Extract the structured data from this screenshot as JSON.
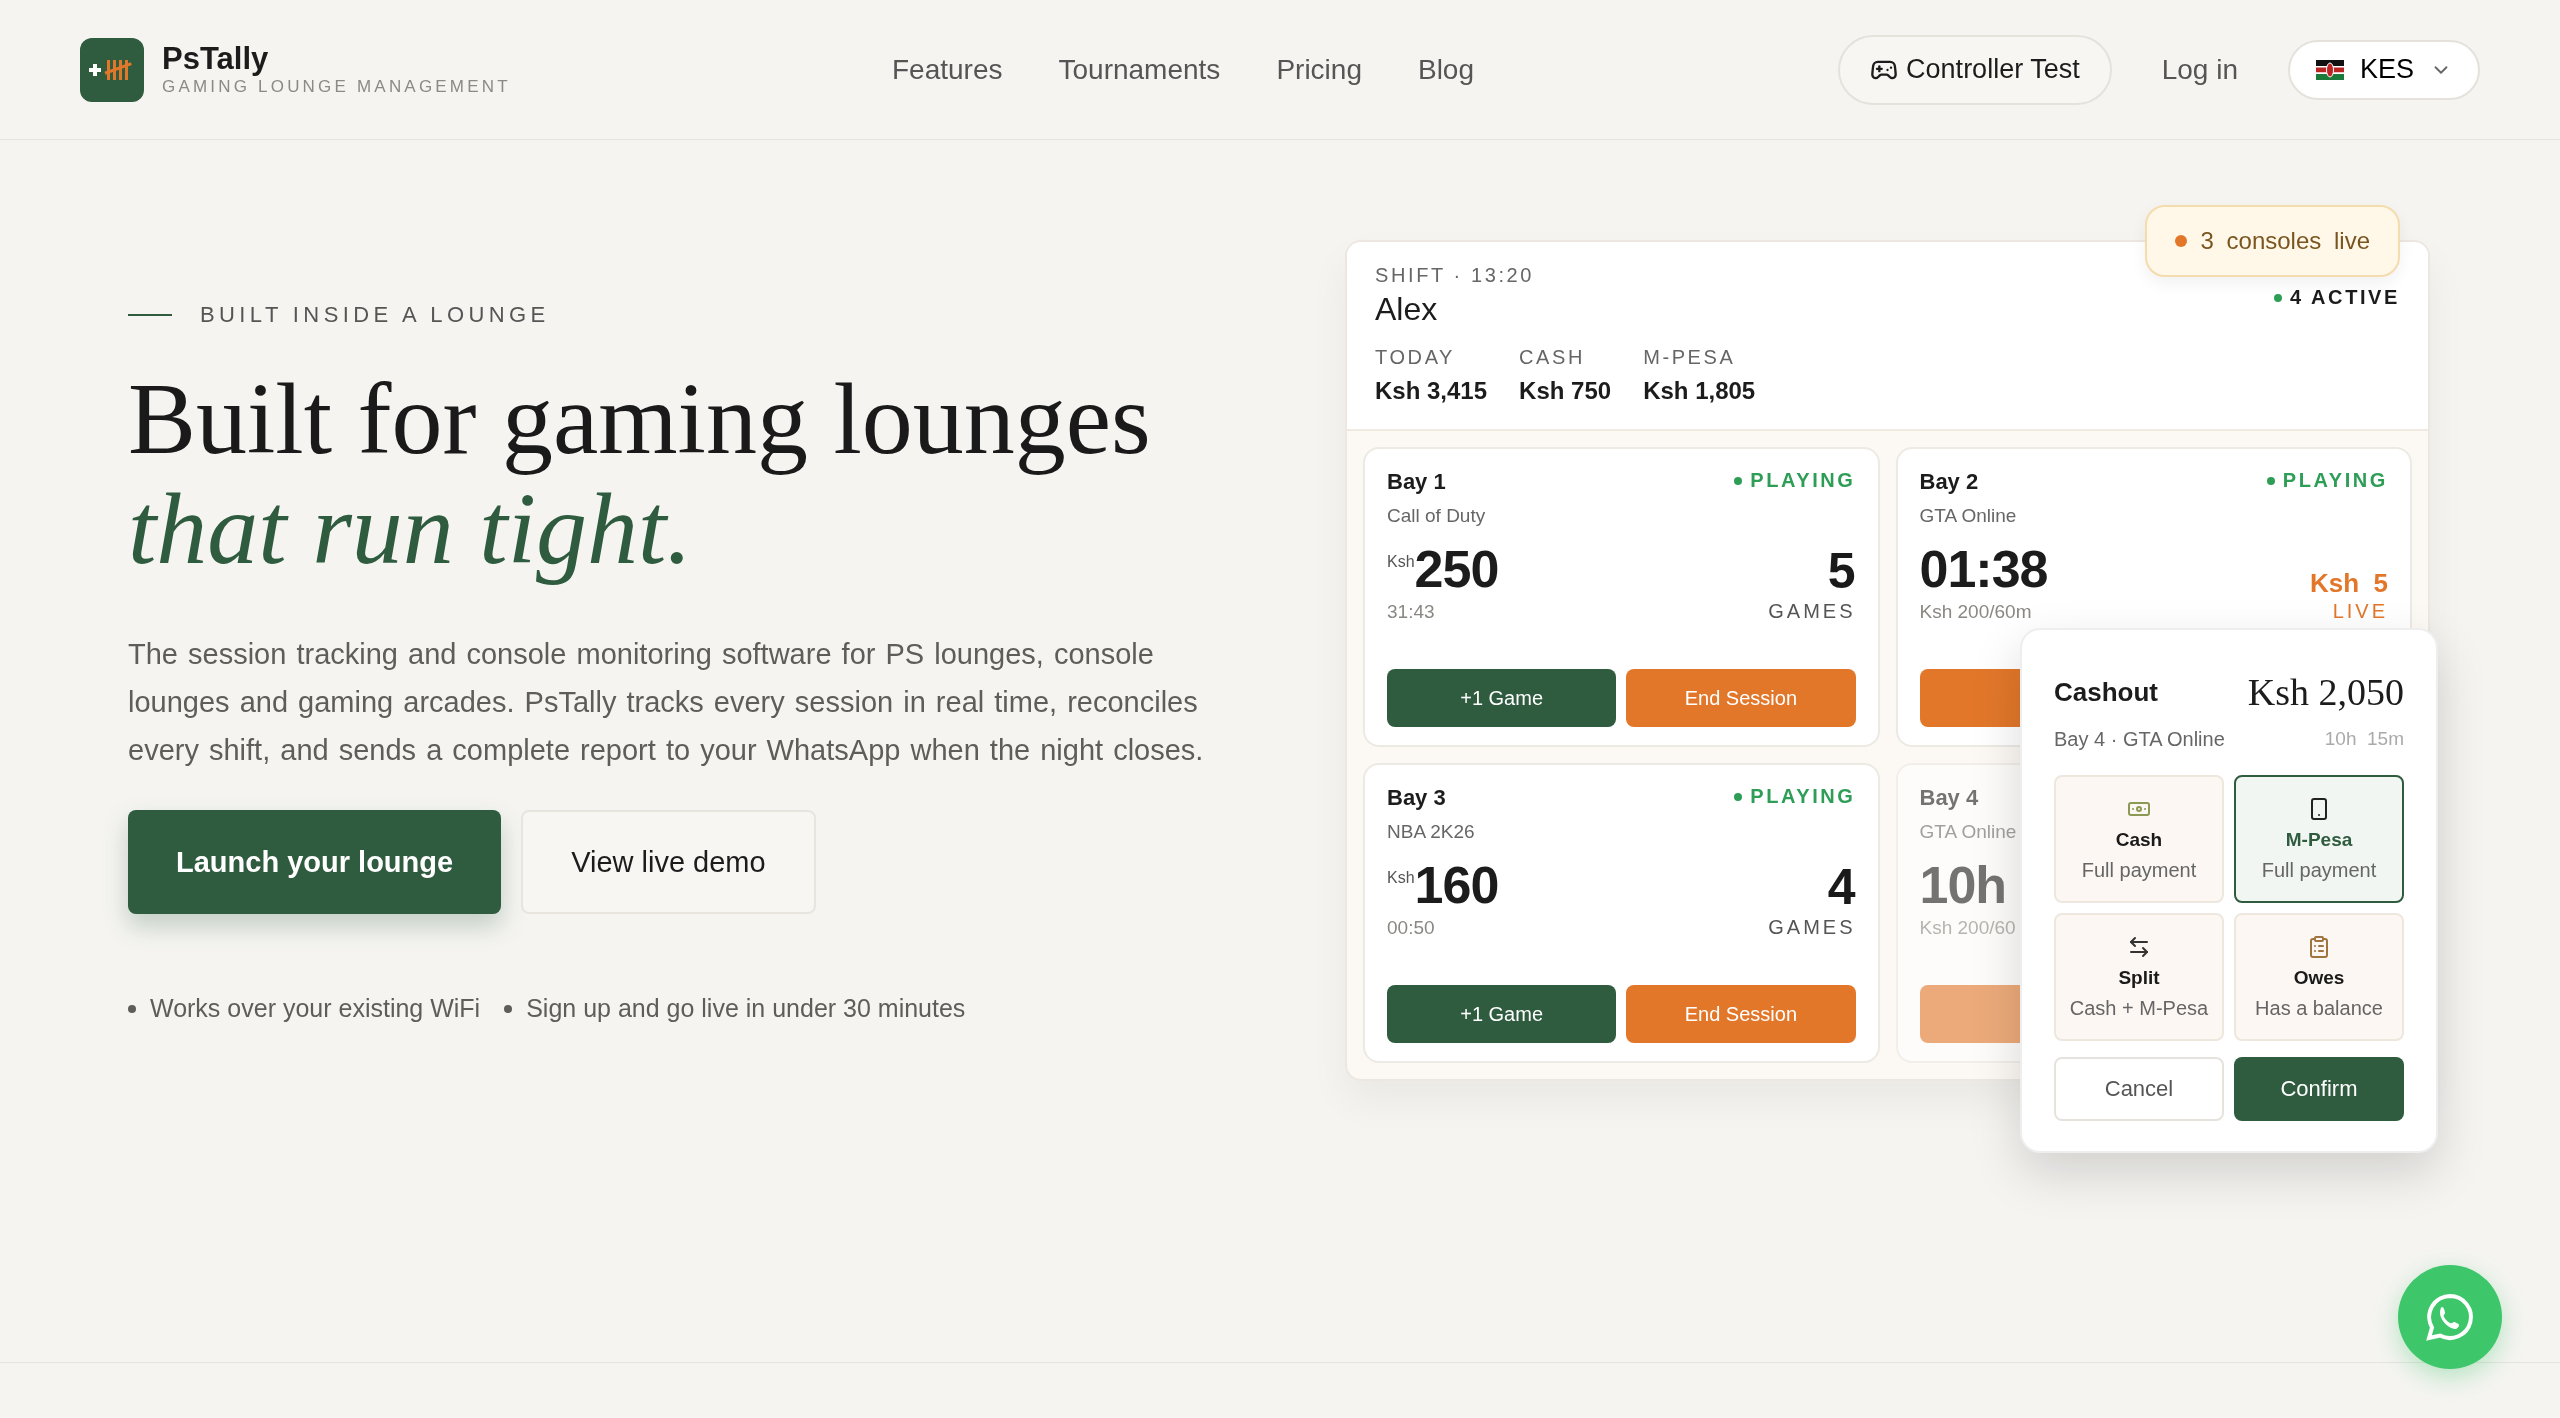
{
  "brand": {
    "name": "PsTally",
    "tagline": "GAMING LOUNGE MANAGEMENT"
  },
  "nav": [
    {
      "label": "Features"
    },
    {
      "label": "Tournaments"
    },
    {
      "label": "Pricing"
    },
    {
      "label": "Blog"
    }
  ],
  "header_actions": {
    "controller_test": "Controller Test",
    "login": "Log in",
    "currency": "KES"
  },
  "hero": {
    "eyebrow": "BUILT INSIDE A LOUNGE",
    "title_line": "Built for gaming lounges",
    "title_accent": "that run tight.",
    "description": "The session tracking and console monitoring software for PS lounges, console lounges and gaming arcades. PsTally tracks every session in real time, reconciles every shift, and sends a complete report to your WhatsApp when the night closes.",
    "primary_button": "Launch your lounge",
    "secondary_button": "View live demo",
    "bullets": [
      "Works over your existing WiFi",
      "Sign up and go live in under 30 minutes"
    ]
  },
  "dashboard": {
    "shift": "SHIFT · 13:20",
    "active": "4 ACTIVE",
    "staff": "Alex",
    "stats": [
      {
        "label": "TODAY",
        "value": "Ksh 3,415"
      },
      {
        "label": "CASH",
        "value": "Ksh 750"
      },
      {
        "label": "M-PESA",
        "value": "Ksh 1,805"
      }
    ],
    "live_badge": {
      "count": "3",
      "label": "consoles",
      "suffix": "live"
    },
    "bays": [
      {
        "name": "Bay 1",
        "game": "Call of Duty",
        "status": "PLAYING",
        "dimmed": false,
        "kind": "amount",
        "prefix": "Ksh",
        "value": "250",
        "sub": "31:43",
        "right": {
          "kind": "games",
          "value": "5",
          "label": "GAMES"
        },
        "buttons": [
          {
            "kind": "add",
            "label": "+1 Game"
          },
          {
            "kind": "end",
            "label": "End Session"
          }
        ]
      },
      {
        "name": "Bay 2",
        "game": "GTA Online",
        "status": "PLAYING",
        "dimmed": false,
        "kind": "timer",
        "value": "01:38",
        "sub": "Ksh 200/60m",
        "right": {
          "kind": "live",
          "value": "Ksh  5",
          "label": "LIVE"
        },
        "buttons": [
          {
            "kind": "end"
          }
        ]
      },
      {
        "name": "Bay 3",
        "game": "NBA 2K26",
        "status": "PLAYING",
        "dimmed": false,
        "kind": "amount",
        "prefix": "Ksh",
        "value": "160",
        "sub": "00:50",
        "right": {
          "kind": "games",
          "value": "4",
          "label": "GAMES"
        },
        "buttons": [
          {
            "kind": "add",
            "label": "+1 Game"
          },
          {
            "kind": "end",
            "label": "End Session"
          }
        ]
      },
      {
        "name": "Bay 4",
        "game": "GTA Online",
        "dimmed": true,
        "kind": "timer",
        "value": "10h",
        "sub": "Ksh 200/60",
        "buttons": [
          {
            "kind": "end"
          }
        ]
      }
    ]
  },
  "cashout": {
    "title": "Cashout",
    "amount": "Ksh 2,050",
    "context": "Bay 4 · GTA Online",
    "duration": "10h  15m",
    "options": [
      {
        "kind": "cash",
        "title": "Cash",
        "subtitle": "Full payment",
        "selected": false
      },
      {
        "kind": "mpesa",
        "title": "M-Pesa",
        "subtitle": "Full payment",
        "selected": true
      },
      {
        "kind": "split",
        "title": "Split",
        "subtitle": "Cash + M-Pesa",
        "selected": false
      },
      {
        "kind": "owes",
        "title": "Owes",
        "subtitle": "Has a balance",
        "selected": false
      }
    ],
    "cancel": "Cancel",
    "confirm": "Confirm"
  }
}
